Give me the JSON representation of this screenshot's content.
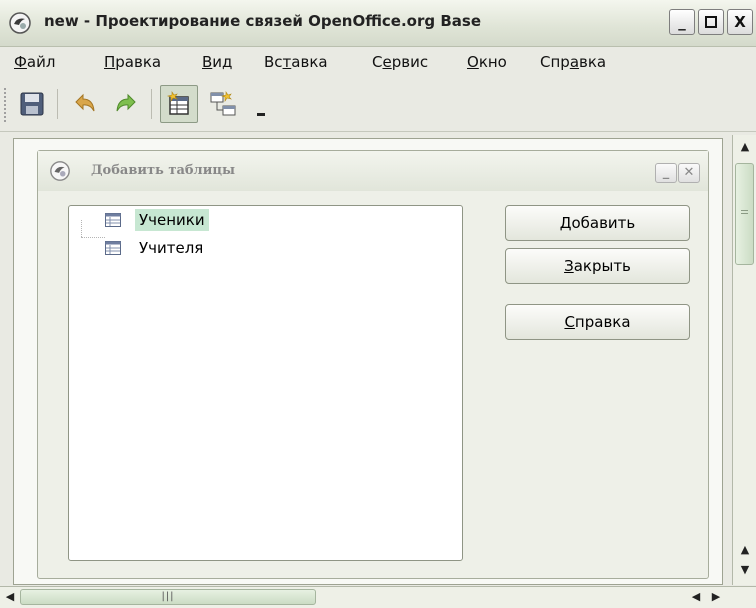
{
  "window": {
    "title": "new - Проектирование связей OpenOffice.org Base",
    "minimize_label": "_",
    "maximize_label": "□",
    "close_label": "X"
  },
  "menu": [
    {
      "label": "Файл",
      "mnemonic": "Ф"
    },
    {
      "label": "Правка",
      "mnemonic": "П"
    },
    {
      "label": "Вид",
      "mnemonic": "В"
    },
    {
      "label": "Вставка",
      "mnemonic": "т"
    },
    {
      "label": "Сервис",
      "mnemonic": "е"
    },
    {
      "label": "Окно",
      "mnemonic": "О"
    },
    {
      "label": "Справка",
      "mnemonic": "а"
    }
  ],
  "toolbar": {
    "icons": [
      "save-icon",
      "undo-icon",
      "redo-icon",
      "add-tables-icon",
      "new-relation-icon",
      "toolbar-options-icon"
    ],
    "active": "add-tables-icon"
  },
  "dialog": {
    "title": "Добавить таблицы",
    "minimize_label": "_",
    "close_label": "✕",
    "tables": [
      {
        "label": "Ученики",
        "selected": true
      },
      {
        "label": "Учителя",
        "selected": false
      }
    ],
    "buttons": {
      "add": {
        "label": "Добавить",
        "mnemonic": "Д"
      },
      "close": {
        "label": "Закрыть",
        "mnemonic": "З"
      },
      "help": {
        "label": "Справка",
        "mnemonic": "С"
      }
    }
  },
  "scrollbars": {
    "h_thumb_grip": "|||"
  },
  "colors": {
    "selection": "#c7e7d2",
    "chrome": "#e9eae3",
    "scroll_thumb": "#cbdcc4"
  }
}
